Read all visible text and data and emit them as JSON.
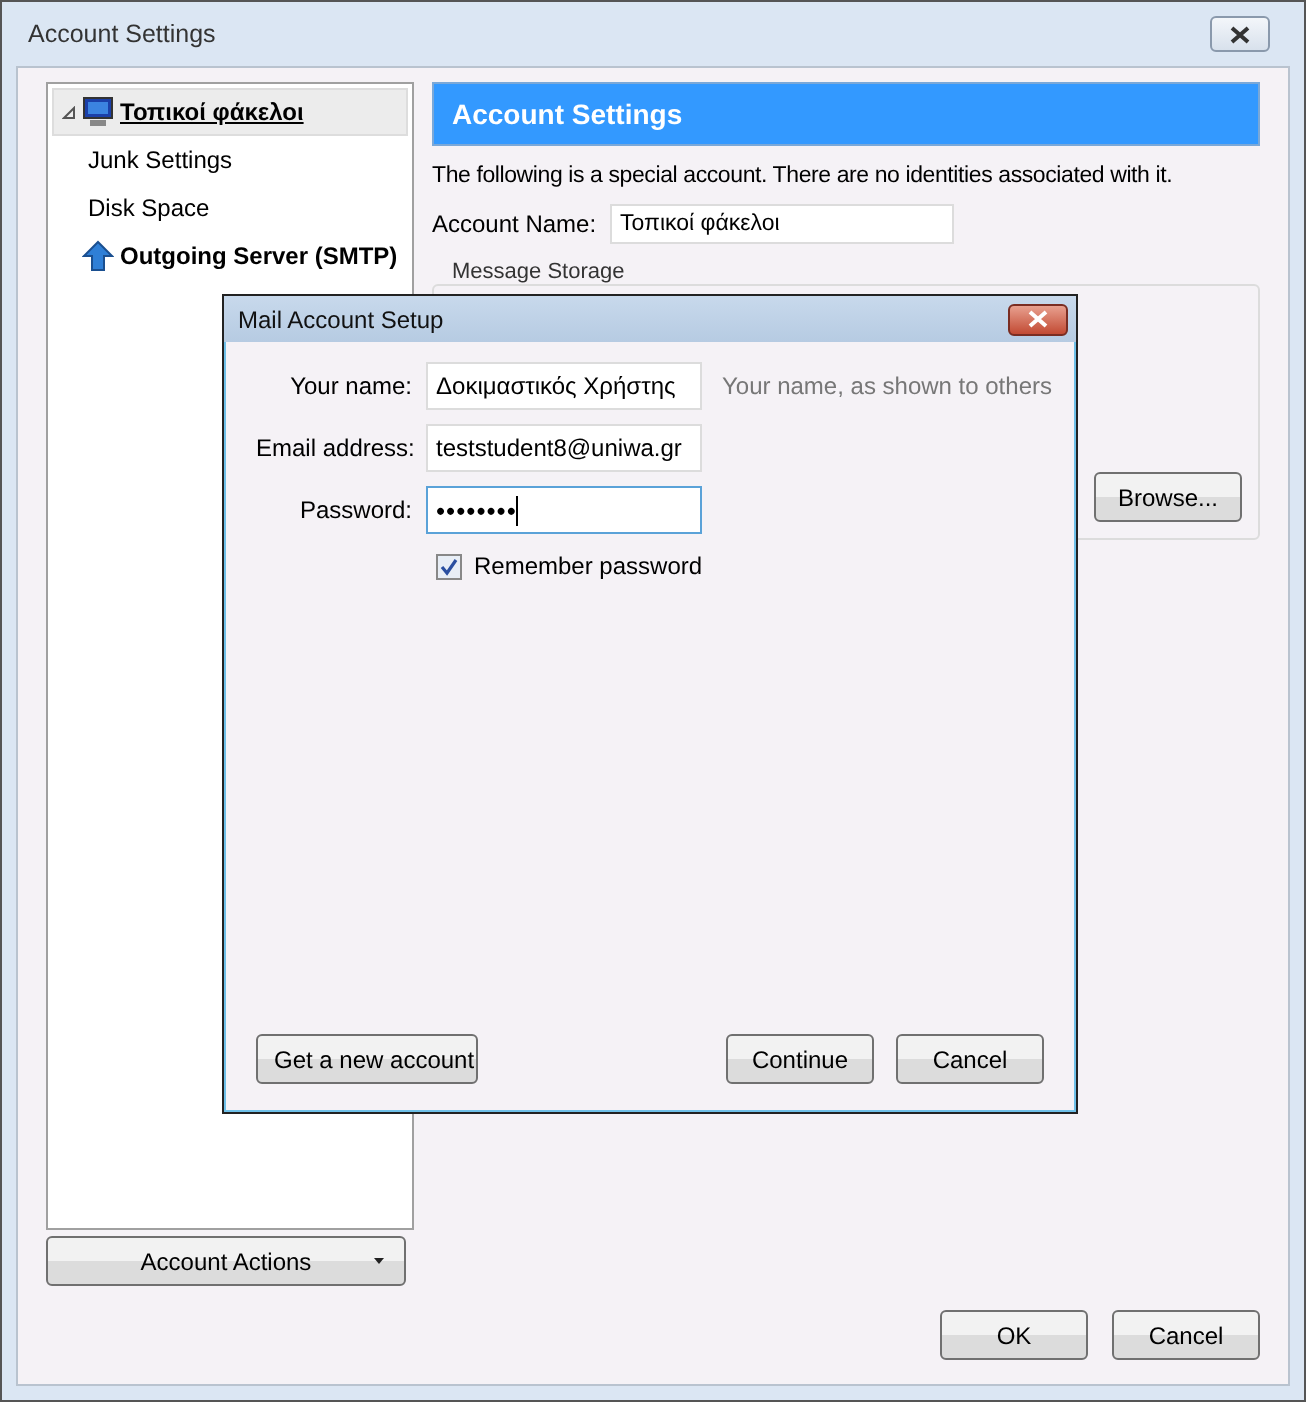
{
  "window": {
    "title": "Account Settings"
  },
  "sidebar": {
    "items": [
      {
        "label": "Τοπικοί φάκελοι",
        "kind": "account",
        "selected": true,
        "expanded": true,
        "children": [
          {
            "label": "Junk Settings",
            "kind": "page",
            "selected": false
          },
          {
            "label": "Disk Space",
            "kind": "page",
            "selected": false
          }
        ]
      },
      {
        "label": "Outgoing Server (SMTP)",
        "kind": "smtp",
        "selected": false
      }
    ]
  },
  "account_actions": {
    "label": "Account Actions"
  },
  "panel": {
    "header": "Account Settings",
    "note": "The following is a special account. There are no identities associated with it.",
    "account_name": {
      "label": "Account Name:",
      "value": "Τοπικοί φάκελοι"
    },
    "storage": {
      "title": "Message Storage",
      "browse": "Browse..."
    }
  },
  "buttons": [
    "OK",
    "Cancel"
  ],
  "dialog": {
    "title": "Mail Account Setup",
    "fields": [
      {
        "label": "Your name:",
        "value": "Δοκιμαστικός Χρήστης",
        "hint": "Your name, as shown to others",
        "kind": "text",
        "focused": false
      },
      {
        "label": "Email address:",
        "value": "teststudent8@uniwa.gr",
        "kind": "text",
        "focused": false
      },
      {
        "label": "Password:",
        "value": "••••••••",
        "kind": "password",
        "focused": true
      }
    ],
    "remember": {
      "label": "Remember password",
      "checked": true
    },
    "buttons": [
      {
        "label": "Get a new account",
        "kind": "left"
      },
      {
        "label": "Continue",
        "kind": "right"
      },
      {
        "label": "Cancel",
        "kind": "right"
      }
    ]
  }
}
